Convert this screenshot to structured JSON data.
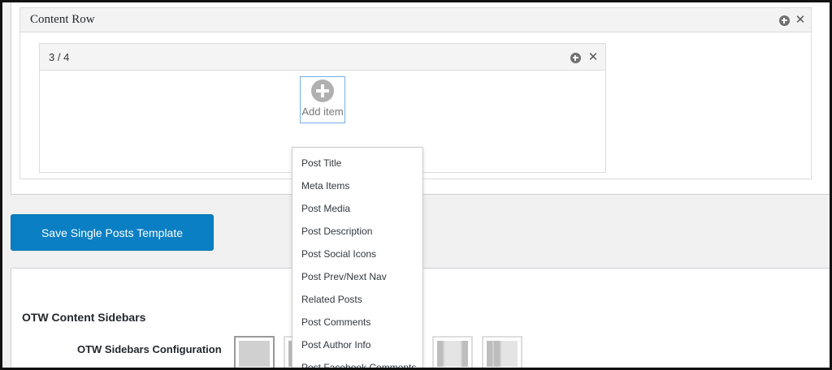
{
  "content_row": {
    "title": "Content Row"
  },
  "column": {
    "title": "3 / 4"
  },
  "add_item": {
    "label": "Add item"
  },
  "dropdown": {
    "items": [
      "Post Title",
      "Meta Items",
      "Post Media",
      "Post Description",
      "Post Social Icons",
      "Post Prev/Next Nav",
      "Related Posts",
      "Post Comments",
      "Post Author Info",
      "Post Facebook Comments"
    ]
  },
  "save_button": {
    "label": "Save Single Posts Template",
    "color": "#0a7fc3"
  },
  "sidebars": {
    "section_title": "OTW Content Sidebars",
    "config_label": "OTW Sidebars Configuration"
  }
}
